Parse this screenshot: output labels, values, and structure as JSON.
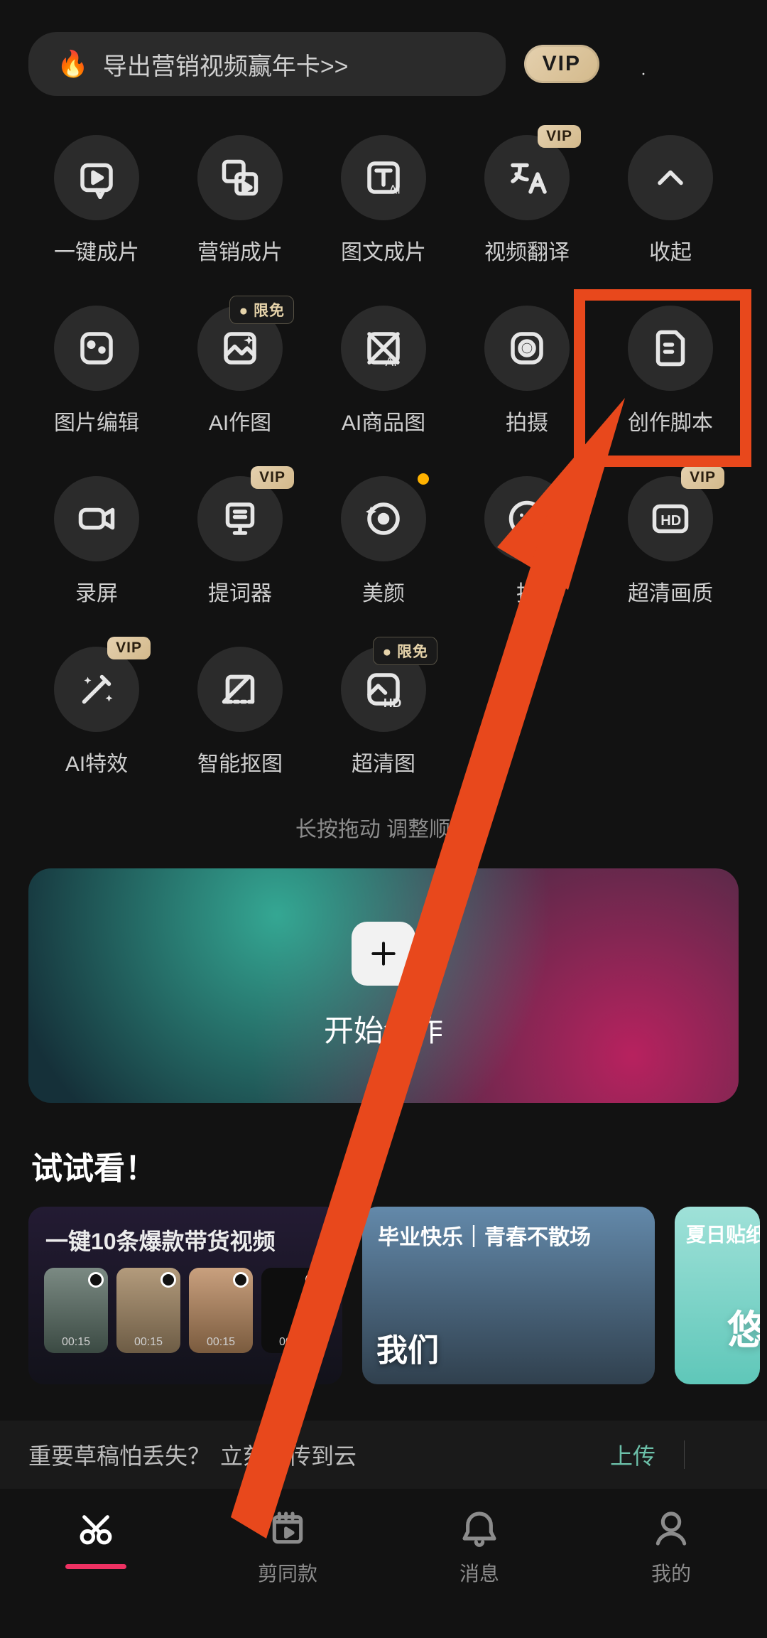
{
  "topbar": {
    "promo": "导出营销视频赢年卡>>",
    "vip": "VIP"
  },
  "tools": [
    {
      "label": "一键成片"
    },
    {
      "label": "营销成片"
    },
    {
      "label": "图文成片"
    },
    {
      "label": "视频翻译",
      "badge": "VIP",
      "badgeType": "vip"
    },
    {
      "label": "收起"
    },
    {
      "label": "图片编辑"
    },
    {
      "label": "AI作图",
      "badge": "限免",
      "badgeType": "limit",
      "badgePrefixDot": true
    },
    {
      "label": "AI商品图"
    },
    {
      "label": "拍摄"
    },
    {
      "label": "创作脚本"
    },
    {
      "label": "录屏"
    },
    {
      "label": "提词器",
      "badge": "VIP",
      "badgeType": "vip"
    },
    {
      "label": "美颜",
      "notifyDot": true
    },
    {
      "label": "拍",
      "hidden": false
    },
    {
      "label": "超清画质",
      "badge": "VIP",
      "badgeType": "vip"
    },
    {
      "label": "AI特效",
      "badge": "VIP",
      "badgeType": "vip"
    },
    {
      "label": "智能抠图"
    },
    {
      "label": "超清图",
      "badge": "限免",
      "badgeType": "limit",
      "badgePrefixDot": true
    }
  ],
  "hint": "长按拖动   调整顺序",
  "create": {
    "label": "开始创作"
  },
  "try": {
    "title": "试试看！"
  },
  "cards": {
    "c1_title": "一键10条爆款带货视频",
    "thumbs": [
      "00:15",
      "00:15",
      "00:15",
      "00:00"
    ],
    "c2_title": "毕业快乐｜青春不散场",
    "c2_text": "我们",
    "c3_title": "夏日贴纸",
    "c3_char": "悠"
  },
  "strip": {
    "q": "重要草稿怕丢失？",
    "a": "立刻上传到云",
    "upload": "上传"
  },
  "nav": [
    "剪同款",
    "消息",
    "我的"
  ]
}
